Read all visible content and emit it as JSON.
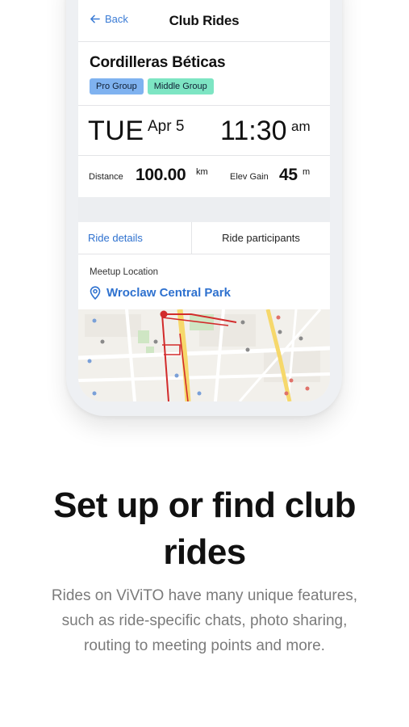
{
  "header": {
    "back_label": "Back",
    "title": "Club Rides"
  },
  "ride": {
    "name": "Cordilleras Béticas",
    "tags": [
      "Pro Group",
      "Middle Group"
    ],
    "day": "TUE",
    "date": "Apr 5",
    "time": "11:30",
    "ampm": "am",
    "distance_label": "Distance",
    "distance_value": "100.00",
    "distance_unit": "km",
    "elev_label": "Elev Gain",
    "elev_value": "45",
    "elev_unit": "m"
  },
  "tabs": {
    "details": "Ride details",
    "participants": "Ride participants"
  },
  "meetup": {
    "label": "Meetup Location",
    "location": "Wroclaw Central Park"
  },
  "marketing": {
    "headline_line1": "Set up or find club",
    "headline_line2": "rides",
    "sub_line1": "Rides on ViViTO have many unique features,",
    "sub_line2": "such as ride-specific chats, photo sharing,",
    "sub_line3": "routing to meeting points and more."
  },
  "colors": {
    "accent": "#2e71cf",
    "pro_tag": "#7fb2f0",
    "middle_tag": "#7de5c3",
    "route": "#d22b2b"
  }
}
